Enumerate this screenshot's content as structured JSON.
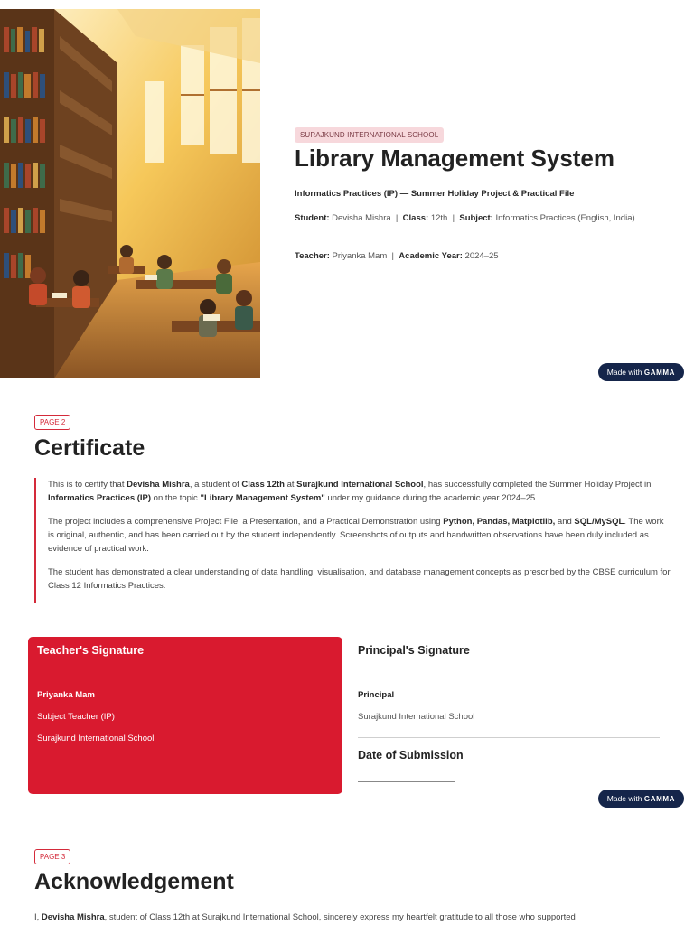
{
  "cover": {
    "school_tag": "SURAJKUND INTERNATIONAL SCHOOL",
    "title": "Library Management System",
    "subtitle": "Informatics Practices (IP) — Summer Holiday Project & Practical File",
    "student_label": "Student:",
    "student_value": "Devisha Mishra",
    "class_label": "Class:",
    "class_value": "12th",
    "subject_label": "Subject:",
    "subject_value": "Informatics Practices (English, India)",
    "teacher_label": "Teacher:",
    "teacher_value": "Priyanka Mam",
    "year_label": "Academic Year:",
    "year_value": "2024–25",
    "separator": "|",
    "image_icon": "library-illustration"
  },
  "badge": {
    "made_with": "Made with",
    "brand": "GAMMA"
  },
  "certificate": {
    "page_tag": "PAGE 2",
    "title": "Certificate",
    "p1": {
      "t1": "This is to certify that ",
      "name": "Devisha Mishra",
      "t2": ", a student of ",
      "class": "Class 12th",
      "t3": " at ",
      "school": "Surajkund International School",
      "t4": ", has successfully completed the Summer Holiday Project in ",
      "subject": "Informatics Practices (IP)",
      "t5": " on the topic ",
      "topic": "\"Library Management System\"",
      "t6": " under my guidance during the academic year 2024–25."
    },
    "p2": {
      "t1": "The project includes a comprehensive Project File, a Presentation, and a Practical Demonstration using ",
      "tools": "Python, Pandas, Matplotlib,",
      "t2": " and ",
      "sql": "SQL/MySQL",
      "t3": ". The work is original, authentic, and has been carried out by the student independently. Screenshots of outputs and handwritten observations have been duly included as evidence of practical work."
    },
    "p3": "The student has demonstrated a clear understanding of data handling, visualisation, and database management concepts as prescribed by the CBSE curriculum for Class 12 Informatics Practices.",
    "teacher_sig": {
      "heading": "Teacher's Signature",
      "name": "Priyanka Mam",
      "role": "Subject Teacher (IP)",
      "school": "Surajkund International School"
    },
    "principal_sig": {
      "heading": "Principal's Signature",
      "name": "Principal",
      "school": "Surajkund International School"
    },
    "date_heading": "Date of Submission"
  },
  "acknowledgement": {
    "page_tag": "PAGE 3",
    "title": "Acknowledgement",
    "t1": "I, ",
    "name": "Devisha Mishra",
    "t2": ", student of Class 12th at Surajkund International School, sincerely express my heartfelt gratitude to all those who supported"
  },
  "colors": {
    "accent": "#d91a2f",
    "tag_bg": "#f7d8dc",
    "badge_bg": "#15254a"
  }
}
